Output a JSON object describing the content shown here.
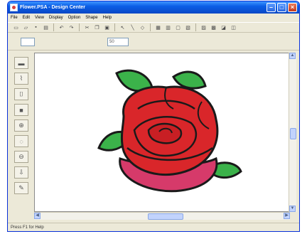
{
  "window": {
    "title": "Flower.PSA - Design Center"
  },
  "menubar": {
    "items": [
      "File",
      "Edit",
      "View",
      "Display",
      "Option",
      "Shape",
      "Help"
    ]
  },
  "toolbar": {
    "buttons": [
      "new-icon",
      "open-icon",
      "save-icon",
      "print-icon",
      "undo-icon",
      "redo-icon",
      "cut-icon",
      "copy-icon",
      "paste-icon",
      "select-icon",
      "line-icon",
      "region-icon",
      "grid-icon",
      "view-icon",
      "zoom-fit-icon",
      "property-icon",
      "export-icon",
      "import-icon",
      "image-icon",
      "sew-icon"
    ]
  },
  "toolbar2": {
    "field1_value": "",
    "field2_value": "50"
  },
  "left_tools": [
    "fill-icon",
    "line-sew-icon",
    "region-sew-icon",
    "paint-icon",
    "zoom-in-icon",
    "zoom-window-icon",
    "zoom-out-icon",
    "move-icon",
    "pick-icon"
  ],
  "statusbar": {
    "text": "Press F1 for Help"
  },
  "colors": {
    "titlebar": "#0a5ee6",
    "rose_red": "#d9262a",
    "rose_pink": "#d63a6a",
    "leaf_green": "#3bb24a",
    "outline": "#1a1a1a"
  }
}
